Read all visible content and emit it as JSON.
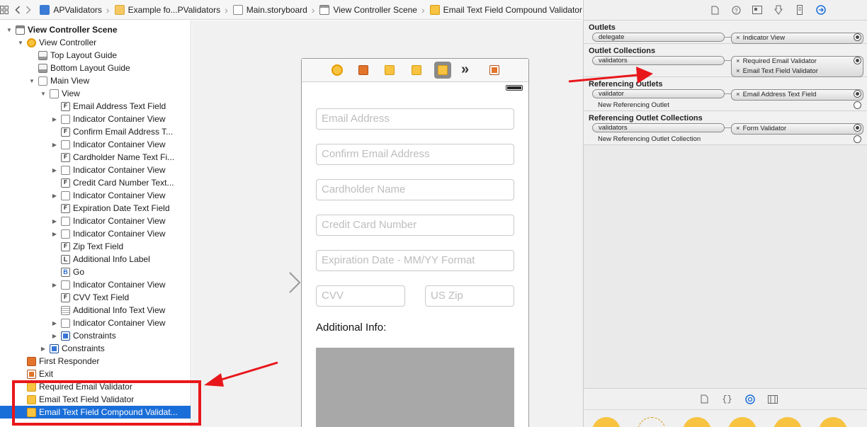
{
  "breadcrumb": [
    "APValidators",
    "Example fo...PValidators",
    "Main.storyboard",
    "View Controller Scene",
    "Email Text Field Compound Validator"
  ],
  "outline": [
    {
      "label": "View Controller Scene",
      "indent": 0,
      "disclosure": "open",
      "icon": "scene",
      "bold": true
    },
    {
      "label": "View Controller",
      "indent": 1,
      "disclosure": "open",
      "icon": "vc"
    },
    {
      "label": "Top Layout Guide",
      "indent": 2,
      "disclosure": "none",
      "icon": "guide"
    },
    {
      "label": "Bottom Layout Guide",
      "indent": 2,
      "disclosure": "none",
      "icon": "guide"
    },
    {
      "label": "Main View",
      "indent": 2,
      "disclosure": "open",
      "icon": "view"
    },
    {
      "label": "View",
      "indent": 3,
      "disclosure": "open",
      "icon": "view"
    },
    {
      "label": "Email Address Text Field",
      "indent": 4,
      "disclosure": "none",
      "icon": "field",
      "glyph": "F"
    },
    {
      "label": "Indicator Container View",
      "indent": 4,
      "disclosure": "closed",
      "icon": "view"
    },
    {
      "label": "Confirm Email Address T...",
      "indent": 4,
      "disclosure": "none",
      "icon": "field",
      "glyph": "F"
    },
    {
      "label": "Indicator Container View",
      "indent": 4,
      "disclosure": "closed",
      "icon": "view"
    },
    {
      "label": "Cardholder Name Text Fi...",
      "indent": 4,
      "disclosure": "none",
      "icon": "field",
      "glyph": "F"
    },
    {
      "label": "Indicator Container View",
      "indent": 4,
      "disclosure": "closed",
      "icon": "view"
    },
    {
      "label": "Credit Card Number Text...",
      "indent": 4,
      "disclosure": "none",
      "icon": "field",
      "glyph": "F"
    },
    {
      "label": "Indicator Container View",
      "indent": 4,
      "disclosure": "closed",
      "icon": "view"
    },
    {
      "label": "Expiration Date Text Field",
      "indent": 4,
      "disclosure": "none",
      "icon": "field",
      "glyph": "F"
    },
    {
      "label": "Indicator Container View",
      "indent": 4,
      "disclosure": "closed",
      "icon": "view"
    },
    {
      "label": "Indicator Container View",
      "indent": 4,
      "disclosure": "closed",
      "icon": "view"
    },
    {
      "label": "Zip Text Field",
      "indent": 4,
      "disclosure": "none",
      "icon": "field",
      "glyph": "F"
    },
    {
      "label": "Additional Info Label",
      "indent": 4,
      "disclosure": "none",
      "icon": "label",
      "glyph": "L"
    },
    {
      "label": "Go",
      "indent": 4,
      "disclosure": "none",
      "icon": "btn",
      "glyph": "B"
    },
    {
      "label": "Indicator Container View",
      "indent": 4,
      "disclosure": "closed",
      "icon": "view"
    },
    {
      "label": "CVV Text Field",
      "indent": 4,
      "disclosure": "none",
      "icon": "field",
      "glyph": "F"
    },
    {
      "label": "Additional Info Text View",
      "indent": 4,
      "disclosure": "none",
      "icon": "textview"
    },
    {
      "label": "Indicator Container View",
      "indent": 4,
      "disclosure": "closed",
      "icon": "view"
    },
    {
      "label": "Constraints",
      "indent": 4,
      "disclosure": "closed",
      "icon": "constraints"
    },
    {
      "label": "Constraints",
      "indent": 3,
      "disclosure": "closed",
      "icon": "constraints"
    },
    {
      "label": "First Responder",
      "indent": 1,
      "disclosure": "none",
      "icon": "responder"
    },
    {
      "label": "Exit",
      "indent": 1,
      "disclosure": "none",
      "icon": "exit"
    },
    {
      "label": "Required Email Validator",
      "indent": 1,
      "disclosure": "none",
      "icon": "cube"
    },
    {
      "label": "Email Text Field Validator",
      "indent": 1,
      "disclosure": "none",
      "icon": "cube"
    },
    {
      "label": "Email Text Field Compound Validat...",
      "indent": 1,
      "disclosure": "none",
      "icon": "cube",
      "selected": true
    }
  ],
  "form": {
    "placeholders": [
      "Email Address",
      "Confirm Email Address",
      "Cardholder Name",
      "Credit Card Number",
      "Expiration Date - MM/YY Format"
    ],
    "cvv_placeholder": "CVV",
    "zip_placeholder": "US Zip",
    "additional_info": "Additional Info:"
  },
  "inspector": {
    "outlets_title": "Outlets",
    "outlets": [
      {
        "name": "delegate",
        "targets": [
          "Indicator View"
        ],
        "connected": true
      }
    ],
    "collections_title": "Outlet Collections",
    "collections": [
      {
        "name": "validators",
        "targets": [
          "Required Email Validator",
          "Email Text Field Validator"
        ],
        "connected": true
      }
    ],
    "ref_title": "Referencing Outlets",
    "ref_outlets": [
      {
        "name": "validator",
        "targets": [
          "Email Address Text Field"
        ],
        "connected": true
      }
    ],
    "ref_new": "New Referencing Outlet",
    "refcoll_title": "Referencing Outlet Collections",
    "ref_collections": [
      {
        "name": "validators",
        "targets": [
          "Form Validator"
        ],
        "connected": true
      }
    ],
    "refcoll_new": "New Referencing Outlet Collection"
  },
  "colors": {
    "selection": "#1a6ed8",
    "annotation_red": "#e8171b"
  }
}
